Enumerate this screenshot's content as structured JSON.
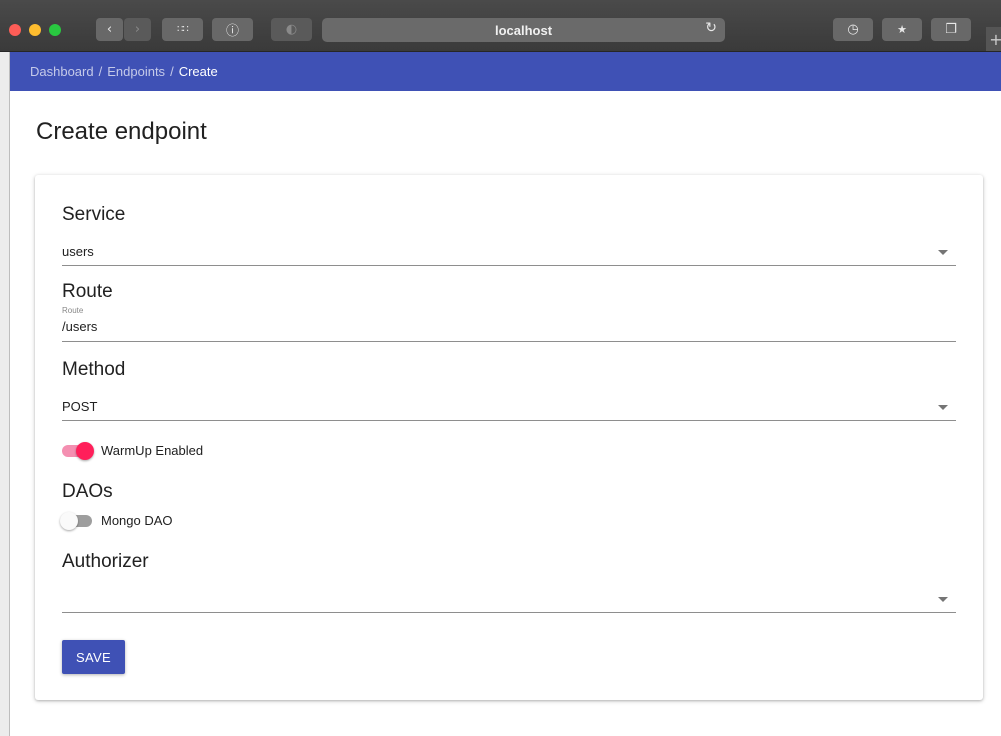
{
  "browser": {
    "url": "localhost",
    "icons": {
      "back": "chevron-left-icon",
      "forward": "chevron-right-icon",
      "apps": "grid-icon",
      "info": "info-icon",
      "privacy": "shield-icon",
      "reload": "reload-icon",
      "history": "clock-icon",
      "download": "download-icon",
      "tabs": "tabs-icon",
      "new_tab": "plus-icon"
    }
  },
  "breadcrumb": {
    "items": [
      "Dashboard",
      "Endpoints",
      "Create"
    ],
    "separator": "/"
  },
  "page": {
    "title": "Create endpoint"
  },
  "form": {
    "service": {
      "label": "Service",
      "value": "users"
    },
    "route": {
      "label": "Route",
      "hint": "Route",
      "value": "/users"
    },
    "method": {
      "label": "Method",
      "value": "POST"
    },
    "warmup": {
      "label": "WarmUp Enabled",
      "checked": true
    },
    "daos": {
      "label": "DAOs",
      "items": [
        {
          "label": "Mongo DAO",
          "checked": false
        }
      ]
    },
    "authorizer": {
      "label": "Authorizer",
      "value": ""
    },
    "save_label": "SAVE"
  },
  "colors": {
    "primary": "#3f51b5",
    "accent": "#ff1f5a",
    "accent_track": "#f48fb1"
  }
}
